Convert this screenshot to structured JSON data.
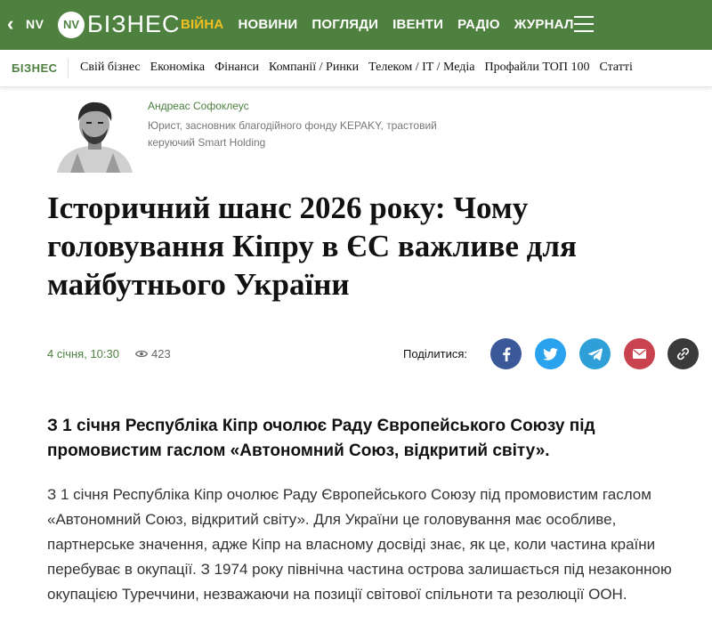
{
  "header": {
    "back_label": "NV",
    "logo_mark": "NV",
    "logo_text": "БІЗНЕС",
    "nav": [
      "ВІЙНА",
      "НОВИНИ",
      "ПОГЛЯДИ",
      "ІВЕНТИ",
      "РАДІО",
      "ЖУРНАЛ"
    ],
    "menu_icon": "hamburger-icon",
    "bg_color": "#4e8040",
    "war_color": "#f0c020"
  },
  "subnav": {
    "section": "БІЗНЕС",
    "items": [
      "Свій бізнес",
      "Економіка",
      "Фінанси",
      "Компанії / Ринки",
      "Телеком / IT / Медіа",
      "Профайли ТОП 100",
      "Статті"
    ]
  },
  "author": {
    "name": "Андреас Софоклеус",
    "description": "Юрист, засновник благодійного фонду KEPAKY, трастовий керуючий Smart Holding"
  },
  "article": {
    "title": "Історичний шанс 2026 року: Чому головування Кіпру в ЄС важливе для майбутнього України",
    "date": "4 січня, 10:30",
    "views": "423",
    "share_label": "Поділитися:",
    "share_icons": [
      "facebook-icon",
      "twitter-icon",
      "telegram-icon",
      "mail-icon",
      "link-icon"
    ],
    "lead": "З 1 січня Республіка Кіпр очолює Раду Європейського Союзу під промовистим гаслом «Автономний Союз, відкритий світу».",
    "body": "З 1 січня Республіка Кіпр очолює Раду Європейського Союзу під промовистим гаслом «Автономний Союз, відкритий світу». Для України це головування має особливе, партнерське значення, адже Кіпр на власному досвіді знає, як це, коли частина країни перебуває в окупації. З 1974 року північна частина острова залишається під незаконною окупацією Туреччини, незважаючи на позиції світової спільноти та резолюції ООН."
  }
}
